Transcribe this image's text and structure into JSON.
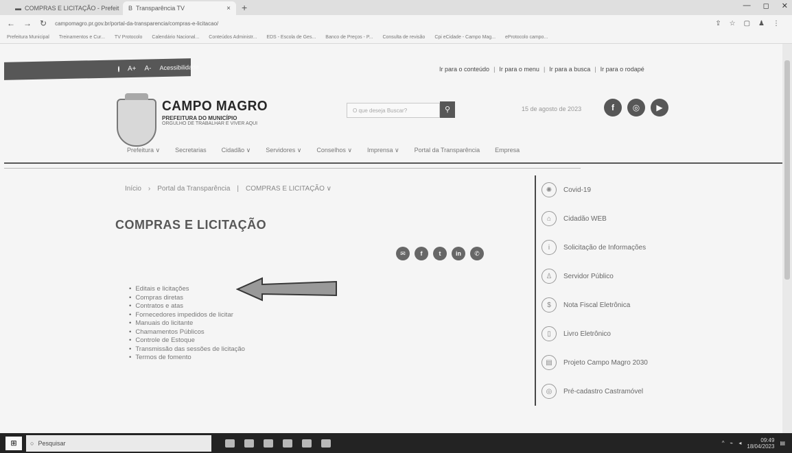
{
  "browser": {
    "tabs": [
      {
        "label": "COMPRAS E LICITAÇÃO - Prefeit"
      },
      {
        "label": "Transparência TV"
      }
    ],
    "new_tab": "+",
    "url": "campomagro.pr.gov.br/portal-da-transparencia/compras-e-licitacao/",
    "bookmarks": [
      "Prefeitura Municipal",
      "Treinamentos e Cur...",
      "TV Protocolo",
      "Calendário Nacional...",
      "Conteúdos Administr...",
      "EDS - Escola de Ges...",
      "Banco de Preços - P...",
      "Consulta de revisão",
      "Cpi eCidade - Campo Mag...",
      "eProtocolo campo..."
    ]
  },
  "accessibility": {
    "font_increase": "A+",
    "font_decrease": "A-",
    "label": "Acessibilidade",
    "skip_links": [
      "Ir para o conteúdo",
      "Ir para o menu",
      "Ir para a busca",
      "Ir para o rodapé"
    ]
  },
  "header": {
    "title": "CAMPO MAGRO",
    "subtitle": "PREFEITURA DO MUNICÍPIO",
    "tagline": "ORGULHO DE TRABALHAR E VIVER AQUI",
    "search_placeholder": "O que deseja Buscar?",
    "date": "15 de agosto de 2023"
  },
  "nav": [
    "Prefeitura ∨",
    "Secretarias",
    "Cidadão ∨",
    "Servidores ∨",
    "Conselhos ∨",
    "Imprensa ∨",
    "Portal da Transparência",
    "Empresa"
  ],
  "breadcrumb": [
    "Início",
    "›",
    "Portal da Transparência",
    "|",
    "COMPRAS E LICITAÇÃO ∨"
  ],
  "page_title": "COMPRAS E LICITAÇÃO",
  "links": [
    "Editais e licitações",
    "Compras diretas",
    "Contratos e atas",
    "Fornecedores impedidos de licitar",
    "Manuais do licitante",
    "Chamamentos Públicos",
    "Controle de Estoque",
    "Transmissão das sessões de licitação",
    "Termos de fomento"
  ],
  "sidebar": [
    {
      "label": "Covid-19",
      "icon": "✺"
    },
    {
      "label": "Cidadão WEB",
      "icon": "⌂"
    },
    {
      "label": "Solicitação de Informações",
      "icon": "i"
    },
    {
      "label": "Servidor Público",
      "icon": "♙"
    },
    {
      "label": "Nota Fiscal Eletrônica",
      "icon": "$"
    },
    {
      "label": "Livro Eletrônico",
      "icon": "▯"
    },
    {
      "label": "Projeto Campo Magro 2030",
      "icon": "▤"
    },
    {
      "label": "Pré-cadastro Castramóvel",
      "icon": "◎"
    }
  ],
  "taskbar": {
    "search": "Pesquisar",
    "time": "09:49",
    "date": "18/04/2023"
  }
}
